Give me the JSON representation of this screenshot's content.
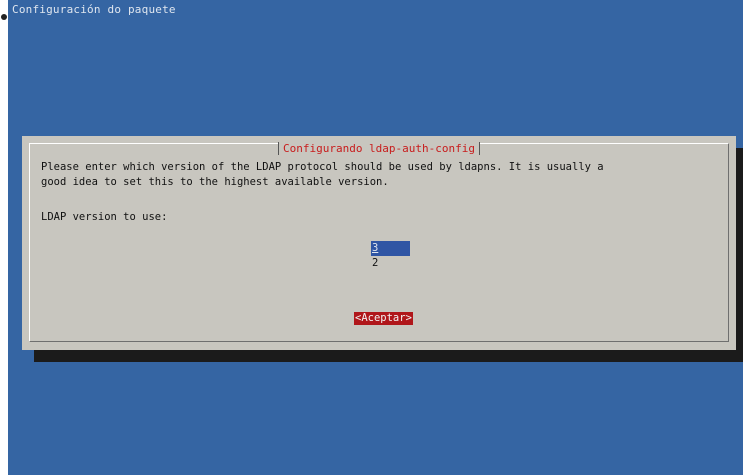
{
  "window": {
    "title": "Configuración do paquete"
  },
  "dialog": {
    "title": "Configurando ldap-auth-config",
    "prompt": "Please enter which version of the LDAP protocol should be used by ldapns. It is usually a\ngood idea to set this to the highest available version.",
    "field_label": "LDAP version to use:",
    "options": [
      {
        "label": "3",
        "selected": true
      },
      {
        "label": "2",
        "selected": false
      }
    ],
    "accept_label": "<Aceptar>"
  },
  "colors": {
    "background": "#3565a3",
    "dialog": "#c8c6bf",
    "title_text": "#c81d1d",
    "selection": "#2f55a4",
    "button": "#b0161a"
  }
}
